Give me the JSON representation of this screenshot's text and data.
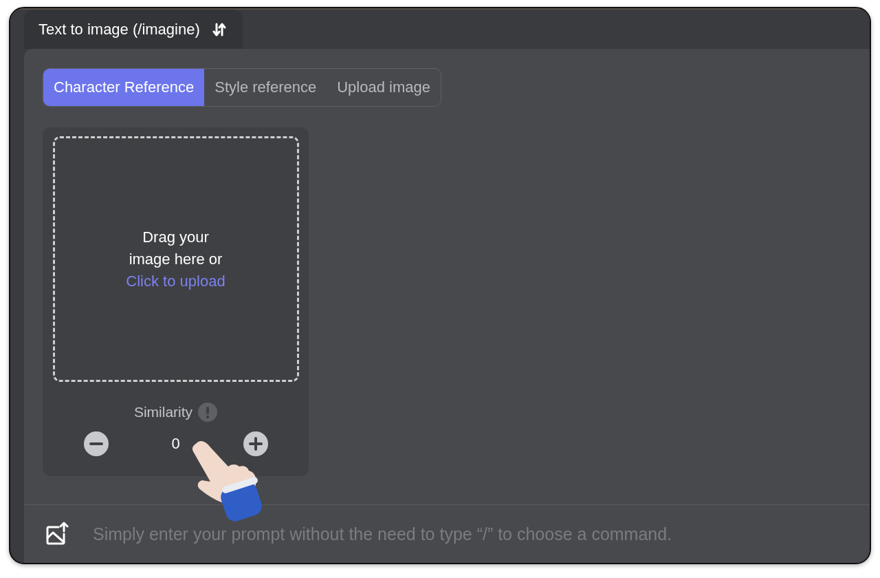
{
  "header_tab": {
    "label": "Text to image (/imagine)"
  },
  "tabs": [
    {
      "label": "Character Reference",
      "selected": true
    },
    {
      "label": "Style reference",
      "selected": false
    },
    {
      "label": "Upload image",
      "selected": false
    }
  ],
  "dropzone": {
    "text": "Drag your image here or",
    "link": "Click to upload"
  },
  "similarity": {
    "label": "Similarity",
    "value": "0"
  },
  "prompt": {
    "placeholder": "Simply enter your prompt without the need to type “/” to choose a command."
  }
}
